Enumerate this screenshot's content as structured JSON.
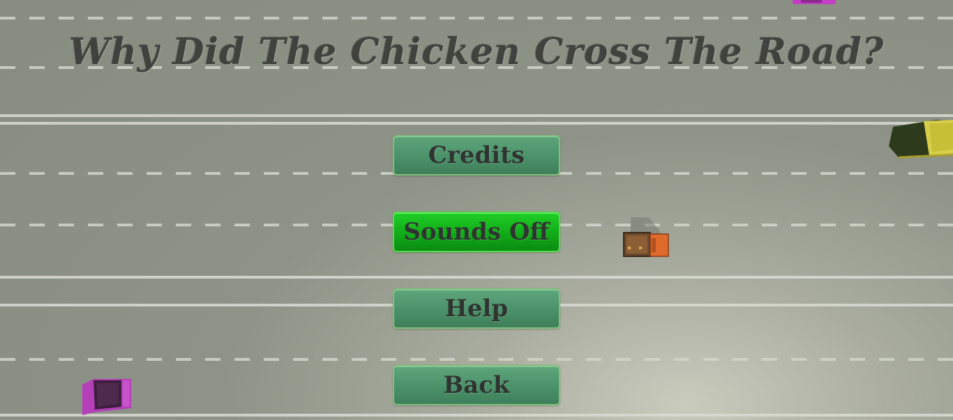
{
  "game": {
    "title": "Why Did The Chicken Cross The Road?"
  },
  "menu": {
    "buttons": [
      {
        "label": "Credits",
        "active": false
      },
      {
        "label": "Sounds Off",
        "active": true
      },
      {
        "label": "Help",
        "active": false
      },
      {
        "label": "Back",
        "active": false
      }
    ]
  },
  "colors": {
    "road": "#8e9387",
    "lane_marking": "#d2d5cb",
    "button": "#4a9169",
    "button_active": "#11aa18",
    "title_text": "#3f423d"
  },
  "vehicles": [
    {
      "type": "car",
      "color": "#c33fc4"
    },
    {
      "type": "truck",
      "color": "#e06a2b"
    },
    {
      "type": "bus",
      "color": "#d7cf4a"
    },
    {
      "type": "car",
      "color": "#b43fb8"
    }
  ]
}
